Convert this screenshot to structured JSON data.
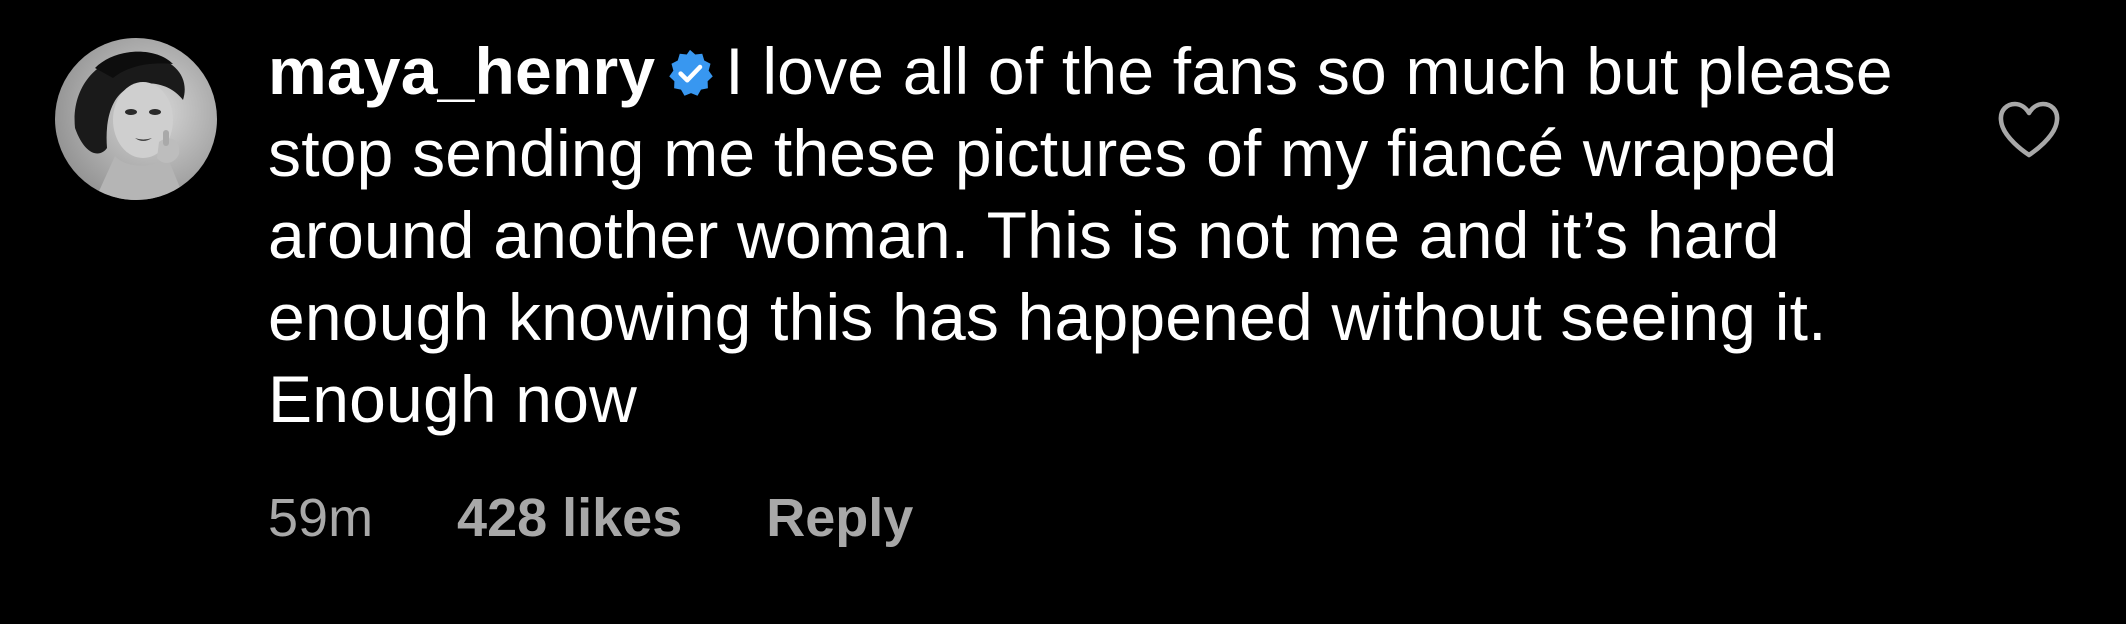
{
  "comment": {
    "username": "maya_henry",
    "verified": true,
    "text": "I love all of the fans so much but please stop sending me these pictures of my fiancé wrapped around another woman. This is not me and it’s hard enough knowing this has happened without seeing it. Enough now",
    "timestamp": "59m",
    "likes": "428 likes",
    "reply_label": "Reply",
    "like_icon": "heart-outline-icon",
    "verified_icon": "verified-badge-icon"
  },
  "colors": {
    "background": "#000000",
    "text": "#ffffff",
    "meta_text": "#a8a8a8",
    "verified_badge": "#3897f0"
  }
}
